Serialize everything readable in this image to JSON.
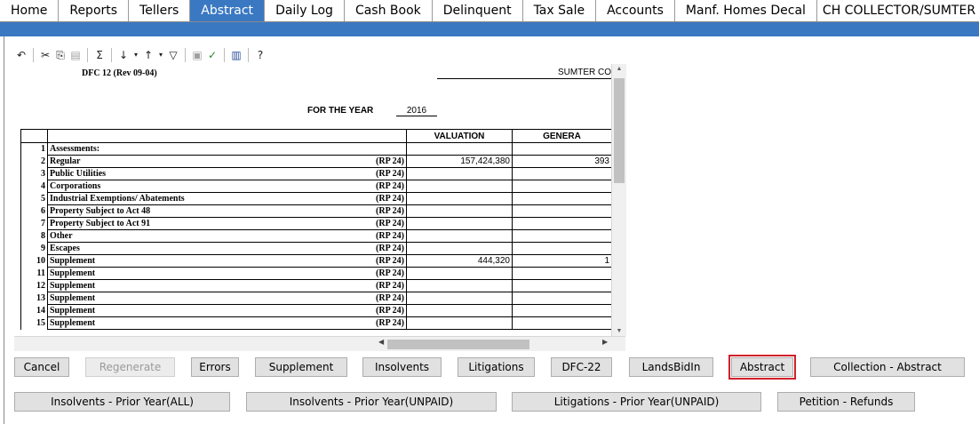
{
  "nav": {
    "tabs": [
      "Home",
      "Reports",
      "Tellers",
      "Abstract",
      "Daily Log",
      "Cash Book",
      "Delinquent",
      "Tax Sale",
      "Accounts",
      "Manf. Homes Decal"
    ],
    "active_index": 3,
    "title": "CH COLLECTOR/SUMTER CO"
  },
  "sheet": {
    "form_id": "DFC 12 (Rev 09-04)",
    "county": "SUMTER COU",
    "year_label": "FOR THE YEAR",
    "year": "2016",
    "col_valuation": "VALUATION",
    "col_general": "GENERA",
    "rows": [
      {
        "n": "1",
        "label": "Assessments:",
        "rp": "",
        "valuation": "",
        "general": ""
      },
      {
        "n": "2",
        "label": "Regular",
        "rp": "(RP 24)",
        "valuation": "157,424,380",
        "general": "393"
      },
      {
        "n": "3",
        "label": "Public Utilities",
        "rp": "(RP 24)",
        "valuation": "",
        "general": ""
      },
      {
        "n": "4",
        "label": "Corporations",
        "rp": "(RP 24)",
        "valuation": "",
        "general": ""
      },
      {
        "n": "5",
        "label": "Industrial Exemptions/ Abatements",
        "rp": "(RP 24)",
        "valuation": "",
        "general": ""
      },
      {
        "n": "6",
        "label": "Property Subject to Act 48",
        "rp": "(RP 24)",
        "valuation": "",
        "general": ""
      },
      {
        "n": "7",
        "label": "Property Subject to Act 91",
        "rp": "(RP 24)",
        "valuation": "",
        "general": ""
      },
      {
        "n": "8",
        "label": "Other",
        "rp": "(RP 24)",
        "valuation": "",
        "general": ""
      },
      {
        "n": "9",
        "label": "Escapes",
        "rp": "(RP 24)",
        "valuation": "",
        "general": ""
      },
      {
        "n": "10",
        "label": "Supplement",
        "rp": "(RP 24)",
        "valuation": "444,320",
        "general": "1"
      },
      {
        "n": "11",
        "label": "Supplement",
        "rp": "(RP 24)",
        "valuation": "",
        "general": ""
      },
      {
        "n": "12",
        "label": "Supplement",
        "rp": "(RP 24)",
        "valuation": "",
        "general": ""
      },
      {
        "n": "13",
        "label": "Supplement",
        "rp": "(RP 24)",
        "valuation": "",
        "general": ""
      },
      {
        "n": "14",
        "label": "Supplement",
        "rp": "(RP 24)",
        "valuation": "",
        "general": ""
      },
      {
        "n": "15",
        "label": "Supplement",
        "rp": "(RP 24)",
        "valuation": "",
        "general": ""
      }
    ]
  },
  "buttons": {
    "cancel": "Cancel",
    "regenerate": "Regenerate",
    "errors": "Errors",
    "supplement": "Supplement",
    "insolvents": "Insolvents",
    "litigations": "Litigations",
    "dfc22": "DFC-22",
    "landsbidin": "LandsBidIn",
    "abstract": "Abstract",
    "collection_abstract": "Collection - Abstract",
    "insolvents_prior_all": "Insolvents - Prior Year(ALL)",
    "insolvents_prior_unpaid": "Insolvents - Prior Year(UNPAID)",
    "litigations_prior_unpaid": "Litigations - Prior Year(UNPAID)",
    "petition_refunds": "Petition - Refunds"
  },
  "colors": {
    "accent": "#3a78c2",
    "highlight": "#d0202a"
  },
  "toolbar_icons": [
    "undo-icon",
    "cut-icon",
    "copy-icon",
    "paste-icon",
    "sum-icon",
    "sort-ascending-icon",
    "sort-descending-icon",
    "filter-icon",
    "protect-icon",
    "spellcheck-icon",
    "export-icon",
    "help-icon"
  ]
}
